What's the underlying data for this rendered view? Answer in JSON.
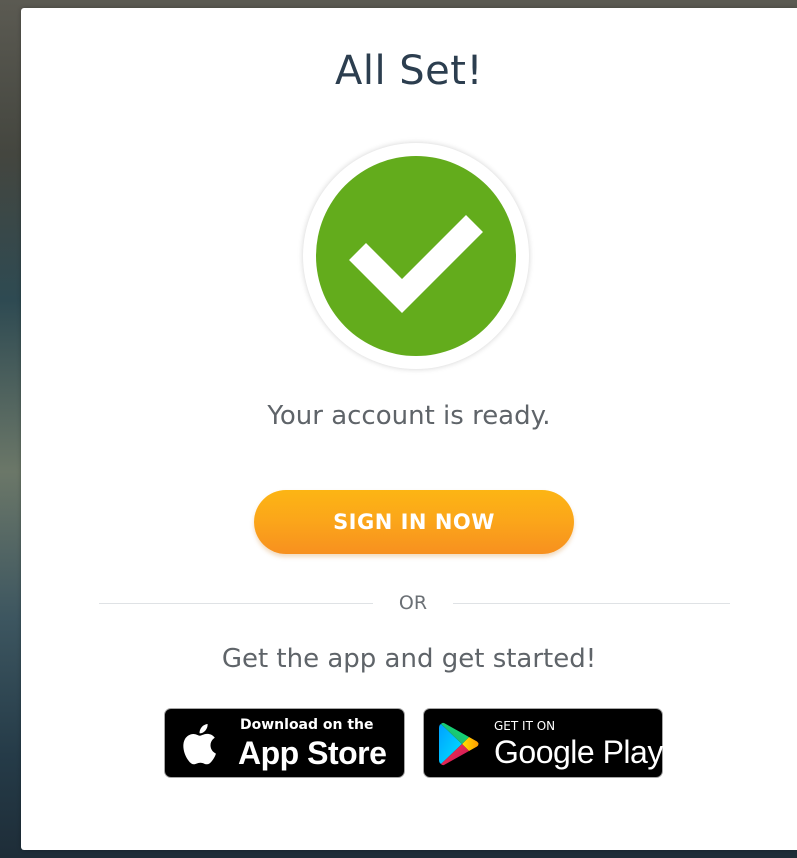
{
  "dialog": {
    "title": "All Set!",
    "message": "Your account is ready.",
    "sign_in_label": "SIGN IN NOW",
    "divider_label": "OR",
    "app_prompt": "Get the app and get started!"
  },
  "stores": {
    "apple": {
      "small_text": "Download on the",
      "big_text": "App Store",
      "icon": "apple-logo-icon"
    },
    "google": {
      "small_text": "GET IT ON",
      "big_text": "Google Play",
      "icon": "google-play-logo-icon"
    }
  },
  "colors": {
    "success_green": "#63ac1c",
    "button_orange_top": "#fcb514",
    "button_orange_bottom": "#f7901f",
    "title_color": "#2c3e4f",
    "text_gray": "#5f6469"
  }
}
